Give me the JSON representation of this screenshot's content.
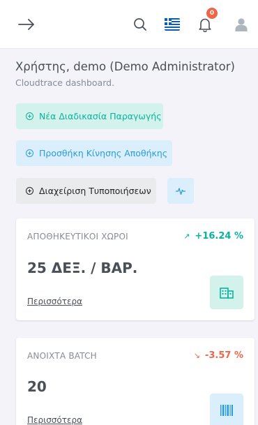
{
  "header": {
    "notification_count": "0",
    "icons": [
      "arrow-right-icon",
      "search-icon",
      "greek-flag-icon",
      "bell-icon",
      "user-icon"
    ]
  },
  "welcome": {
    "greeting_prefix": "Χρήστης,",
    "user_name": "demo (Demo Administrator)",
    "subtitle": "Cloudtrace dashboard."
  },
  "actions": {
    "new_production": "Νέα Διαδικασία Παραγωγής",
    "add_movement": "Προσθήκη Κίνησης Αποθήκης",
    "manage_notifications": "Διαχείριση Τυποποιήσεων"
  },
  "cards": [
    {
      "title": "ΑΠΟΘΗΚΕΥΤΙΚΟΙ ΧΩΡΟΙ",
      "change": "+16.24 %",
      "trend": "up",
      "value": "25 ΔΕΞ. / ΒΑΡ.",
      "link": "Περισσότερα",
      "icon": "warehouse-icon"
    },
    {
      "title": "ΑΝΟΙΧΤΑ BATCH",
      "change": "-3.57 %",
      "trend": "down",
      "value": "20",
      "link": "Περισσότερα",
      "icon": "barcode-icon"
    }
  ],
  "colors": {
    "success": "#0ab39c",
    "info": "#299cdb",
    "danger": "#f06548",
    "muted": "#878a99"
  }
}
